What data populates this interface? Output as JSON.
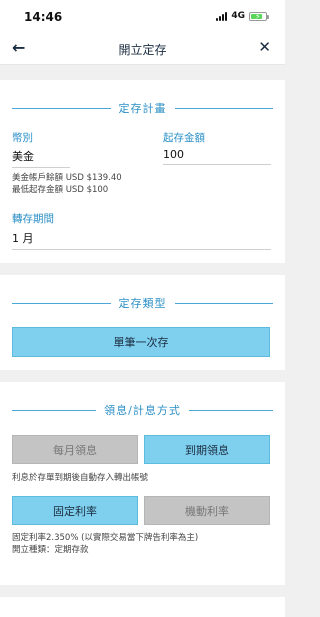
{
  "status_bar": {
    "time": "14:46",
    "network": "4G"
  },
  "nav": {
    "title": "開立定存"
  },
  "plan": {
    "section_title": "定存計畫",
    "currency_label": "幣別",
    "currency_value": "美金",
    "amount_label": "起存金額",
    "amount_value": "100",
    "balance_line": "美金帳戶餘額 USD $139.40",
    "minimum_line": "最低起存金額 USD $100",
    "period_label": "轉存期間",
    "period_value": "1 月"
  },
  "type": {
    "section_title": "定存類型",
    "button_label": "單筆一次存"
  },
  "interest": {
    "section_title": "領息/計息方式",
    "monthly_label": "每月領息",
    "maturity_label": "到期領息",
    "payout_note": "利息於存單到期後自動存入轉出帳號",
    "fixed_label": "固定利率",
    "floating_label": "機動利率",
    "rate_note": "固定利率2.350% (以實際交易當下牌告利率為主)",
    "deposit_type_note": "開立種類：定期存款"
  }
}
